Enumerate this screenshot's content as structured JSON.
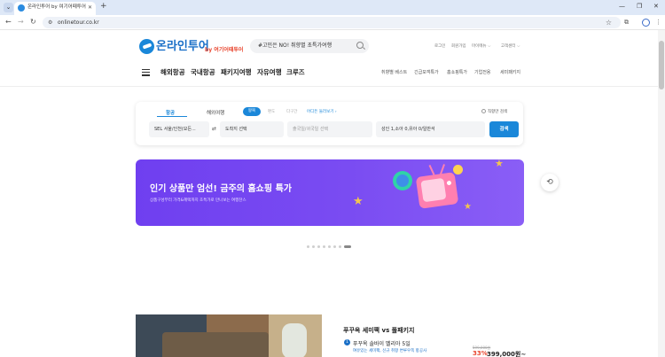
{
  "browser": {
    "tab_title": "온라인투어 by 여기어때투어",
    "url": "onlinetour.co.kr",
    "icons": [
      "tab-list-icon",
      "close-icon",
      "new-tab-icon",
      "minimize-icon",
      "maximize-icon",
      "window-close-icon",
      "back-icon",
      "forward-icon",
      "reload-icon",
      "site-info-icon",
      "bookmark-star-icon",
      "extensions-icon",
      "sidebar-icon",
      "profile-icon",
      "menu-icon"
    ]
  },
  "header": {
    "logo": "온라인투어",
    "logo_sub": "by 여기어때투어",
    "search_text": "#고민은 NO! 취향별 초특가여행",
    "util": {
      "login": "로그인",
      "signup": "회원가입",
      "my_menu": "마이메뉴 ⌵",
      "customer_center": "고객센터 ⌵"
    }
  },
  "nav": {
    "main": [
      "해외항공",
      "국내항공",
      "패키지여행",
      "자유여행",
      "크루즈"
    ],
    "sub": [
      "취향별 베스트",
      "긴급모객특가",
      "홈쇼핑특가",
      "기업전용",
      "세미패키지"
    ]
  },
  "search_panel": {
    "tabs": [
      "항공",
      "해외여행"
    ],
    "trip_types": [
      "왕복",
      "편도",
      "다구간"
    ],
    "where_link": "어디든 둘러보기 ›",
    "direct_only": "직항만 검색",
    "origin": "SEL 서울/인천(모든...",
    "destination": "도착지 선택",
    "dates": "출국일/귀국일 선택",
    "passengers": "성인 1,소아 0,유아 0/일반석",
    "search_btn": "검색"
  },
  "banner": {
    "title": "인기 상품만 엄선! 금주의 홈쇼핑 특가",
    "subtitle": "상품구성부터 가격&혜택까지 초특가로 만나보는 여행찬스"
  },
  "carousel": {
    "count": 8,
    "active": 7
  },
  "deal": {
    "section_title": "푸꾸옥 세미팩 vs 풀패키지",
    "item_number": "1",
    "item_name": "푸꾸옥 솔바이 멜리아 5일",
    "item_desc": "여유있는 세미팩, 신규 취항 변루우쪽 항공사",
    "old_price": "599,000원",
    "discount": "33%",
    "price": "399,000원~"
  },
  "colors": {
    "brand": "#1a87d9",
    "banner": "#7a4cf2",
    "sale": "#e8452e"
  }
}
